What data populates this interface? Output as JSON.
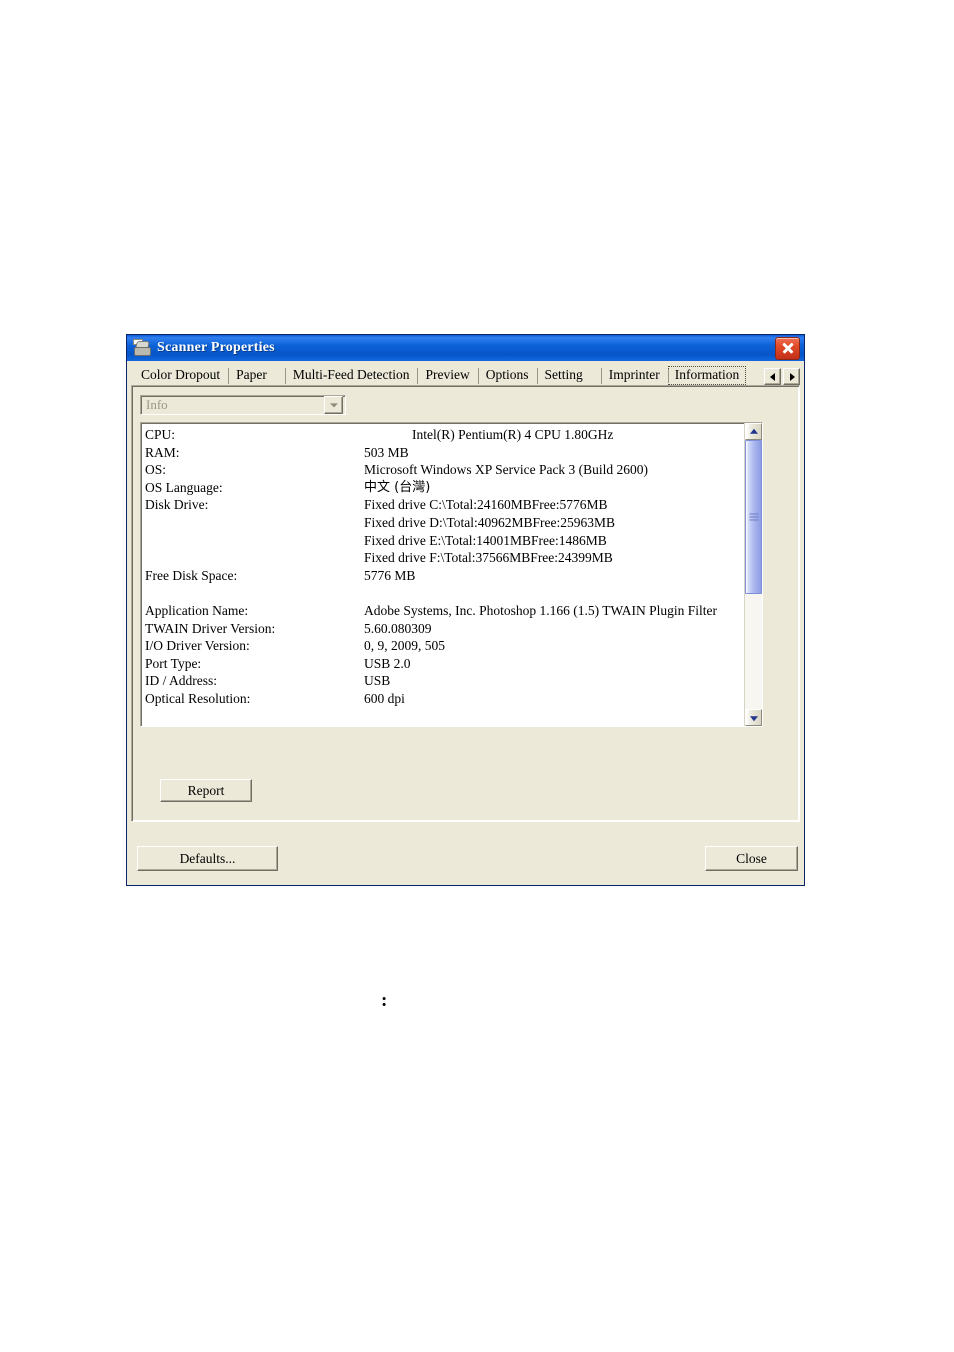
{
  "window": {
    "title": "Scanner Properties",
    "icon": "scanner-icon",
    "close_icon": "close-icon"
  },
  "tabs": [
    {
      "label": "Color Dropout",
      "selected": false
    },
    {
      "label": "Paper",
      "selected": false
    },
    {
      "label": "Multi-Feed Detection",
      "selected": false
    },
    {
      "label": "Preview",
      "selected": false
    },
    {
      "label": "Options",
      "selected": false
    },
    {
      "label": "Setting",
      "selected": false
    },
    {
      "label": "Imprinter",
      "selected": false
    },
    {
      "label": "Information",
      "selected": true
    }
  ],
  "tab_nav": {
    "prev_icon": "chevron-left-icon",
    "next_icon": "chevron-right-icon"
  },
  "combo": {
    "value": "Info",
    "disabled": true,
    "arrow_icon": "chevron-down-icon"
  },
  "info_rows": [
    {
      "label": "CPU:",
      "value": "Intel(R) Pentium(R) 4 CPU 1.80GHz",
      "indent": true
    },
    {
      "label": "RAM:",
      "value": "503 MB"
    },
    {
      "label": "OS:",
      "value": "Microsoft Windows XP Service Pack 3 (Build 2600)"
    },
    {
      "label": "OS Language:",
      "value": "中文 (台灣)",
      "cjk": true
    },
    {
      "label": "Disk Drive:",
      "value": "Fixed drive C:\\Total:24160MBFree:5776MB"
    },
    {
      "label": "",
      "value": "Fixed drive D:\\Total:40962MBFree:25963MB"
    },
    {
      "label": "",
      "value": "Fixed drive E:\\Total:14001MBFree:1486MB"
    },
    {
      "label": "",
      "value": "Fixed drive F:\\Total:37566MBFree:24399MB"
    },
    {
      "label": "Free Disk Space:",
      "value": "5776 MB"
    },
    {
      "label": "",
      "value": ""
    },
    {
      "label": "Application Name:",
      "value": "Adobe Systems, Inc. Photoshop 1.166 (1.5) TWAIN Plugin Filter"
    },
    {
      "label": "TWAIN Driver Version:",
      "value": "5.60.080309"
    },
    {
      "label": "I/O Driver Version:",
      "value": "0, 9, 2009, 505"
    },
    {
      "label": "Port Type:",
      "value": "USB 2.0"
    },
    {
      "label": "ID / Address:",
      "value": "USB"
    },
    {
      "label": "Optical Resolution:",
      "value": "600 dpi"
    }
  ],
  "scrollbar": {
    "up_icon": "chevron-up-icon",
    "down_icon": "chevron-down-icon",
    "thumb_position": "top"
  },
  "buttons": {
    "report": "Report",
    "defaults": "Defaults...",
    "close": "Close"
  },
  "page": {
    "stray_glyph": ":"
  },
  "colors": {
    "dialog_face": "#ece9d8",
    "titlebar_blue": "#0d62d8",
    "close_red": "#d3431f",
    "scroll_thumb": "#aab6ee",
    "list_background": "#ffffff",
    "disabled_text": "#9b9788"
  }
}
